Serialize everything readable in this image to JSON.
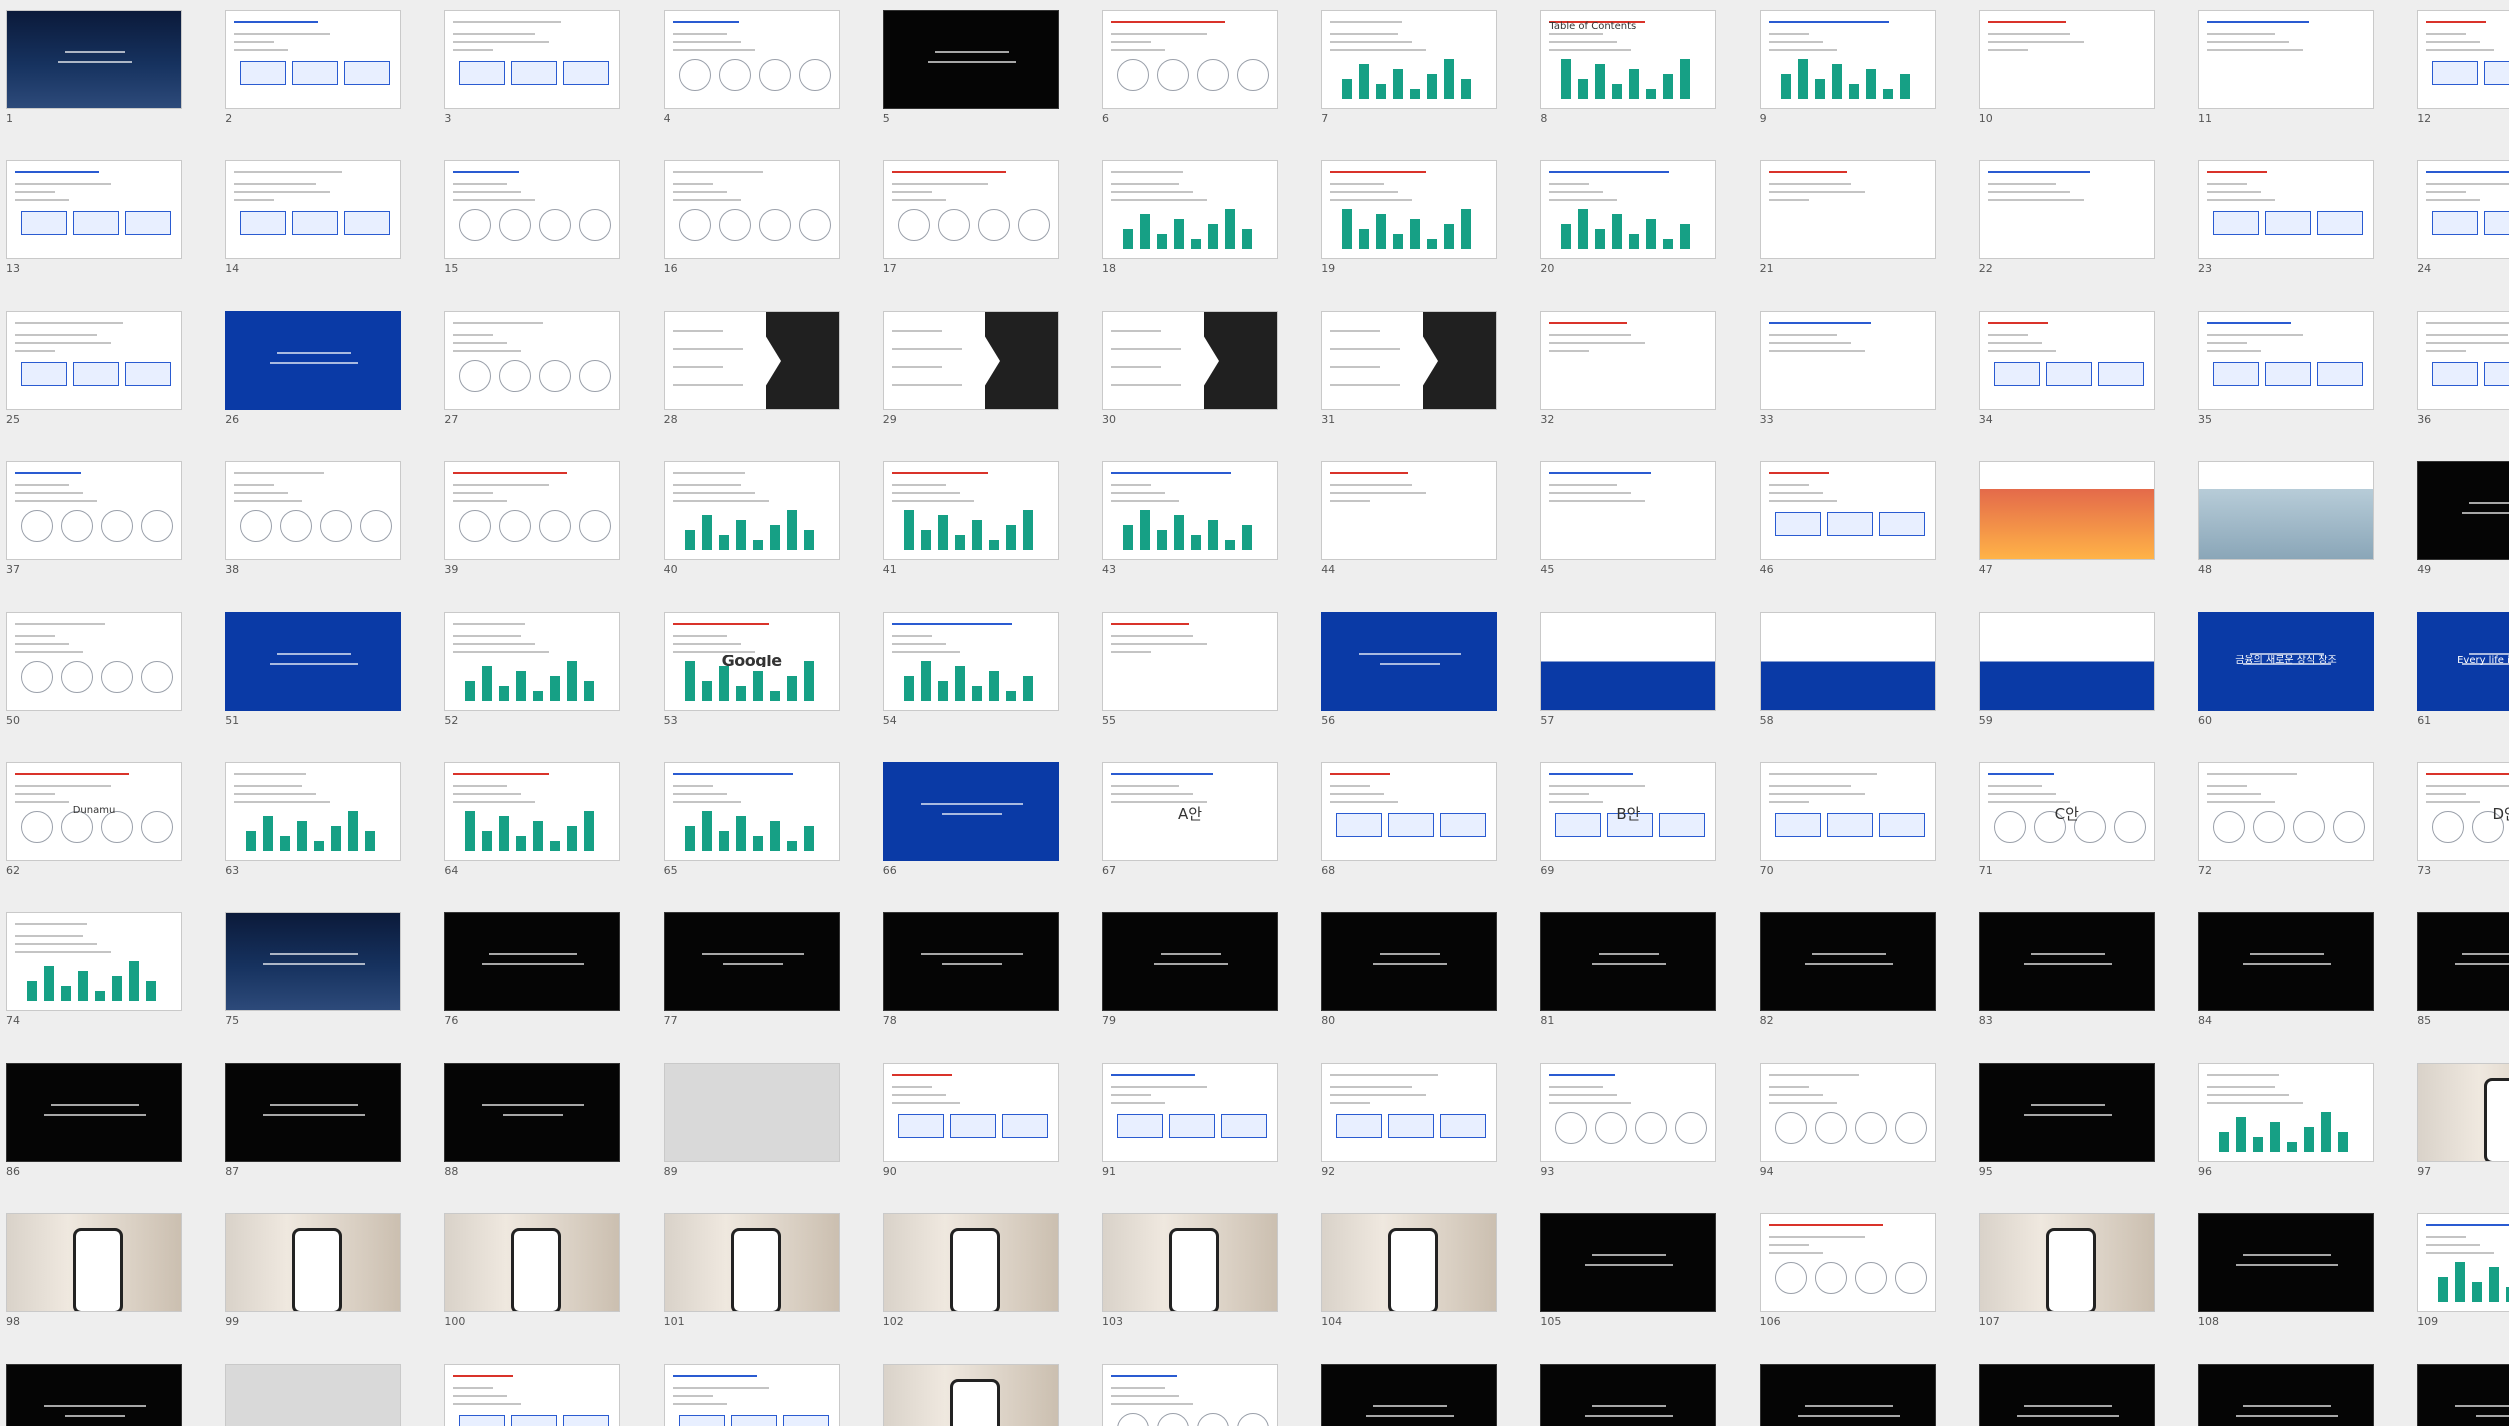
{
  "slides": [
    {
      "n": "1",
      "kind": "city",
      "text": ""
    },
    {
      "n": "2",
      "kind": "white",
      "text": ""
    },
    {
      "n": "3",
      "kind": "white",
      "text": ""
    },
    {
      "n": "4",
      "kind": "white",
      "text": ""
    },
    {
      "n": "5",
      "kind": "black",
      "text": ""
    },
    {
      "n": "6",
      "kind": "white",
      "text": ""
    },
    {
      "n": "7",
      "kind": "white",
      "text": ""
    },
    {
      "n": "8",
      "kind": "white",
      "text": "Table of Contents"
    },
    {
      "n": "9",
      "kind": "white",
      "text": ""
    },
    {
      "n": "10",
      "kind": "white",
      "text": ""
    },
    {
      "n": "11",
      "kind": "white",
      "text": ""
    },
    {
      "n": "12",
      "kind": "white",
      "text": ""
    },
    {
      "n": "13",
      "kind": "white",
      "text": ""
    },
    {
      "n": "14",
      "kind": "white",
      "text": ""
    },
    {
      "n": "15",
      "kind": "white",
      "text": ""
    },
    {
      "n": "16",
      "kind": "white",
      "text": ""
    },
    {
      "n": "17",
      "kind": "white",
      "text": ""
    },
    {
      "n": "18",
      "kind": "white",
      "text": ""
    },
    {
      "n": "19",
      "kind": "white",
      "text": ""
    },
    {
      "n": "20",
      "kind": "white",
      "text": ""
    },
    {
      "n": "21",
      "kind": "white",
      "text": ""
    },
    {
      "n": "22",
      "kind": "white",
      "text": ""
    },
    {
      "n": "23",
      "kind": "white",
      "text": ""
    },
    {
      "n": "24",
      "kind": "white",
      "text": ""
    },
    {
      "n": "25",
      "kind": "white",
      "text": ""
    },
    {
      "n": "26",
      "kind": "blue",
      "text": ""
    },
    {
      "n": "27",
      "kind": "white",
      "text": ""
    },
    {
      "n": "28",
      "kind": "split",
      "text": ""
    },
    {
      "n": "29",
      "kind": "split",
      "text": ""
    },
    {
      "n": "30",
      "kind": "split",
      "text": ""
    },
    {
      "n": "31",
      "kind": "split",
      "text": ""
    },
    {
      "n": "32",
      "kind": "white",
      "text": ""
    },
    {
      "n": "33",
      "kind": "white",
      "text": ""
    },
    {
      "n": "34",
      "kind": "white",
      "text": ""
    },
    {
      "n": "35",
      "kind": "white",
      "text": ""
    },
    {
      "n": "36",
      "kind": "white",
      "text": ""
    },
    {
      "n": "37",
      "kind": "white",
      "text": ""
    },
    {
      "n": "38",
      "kind": "white",
      "text": ""
    },
    {
      "n": "39",
      "kind": "white",
      "text": ""
    },
    {
      "n": "40",
      "kind": "white",
      "text": ""
    },
    {
      "n": "41",
      "kind": "white",
      "text": ""
    },
    {
      "n": "43",
      "kind": "white",
      "text": ""
    },
    {
      "n": "44",
      "kind": "white",
      "text": ""
    },
    {
      "n": "45",
      "kind": "white",
      "text": ""
    },
    {
      "n": "46",
      "kind": "white",
      "text": ""
    },
    {
      "n": "47",
      "kind": "red",
      "text": ""
    },
    {
      "n": "48",
      "kind": "store",
      "text": ""
    },
    {
      "n": "49",
      "kind": "black",
      "text": ""
    },
    {
      "n": "50",
      "kind": "white",
      "text": ""
    },
    {
      "n": "51",
      "kind": "blue",
      "text": ""
    },
    {
      "n": "52",
      "kind": "white",
      "text": ""
    },
    {
      "n": "53",
      "kind": "white",
      "text": "Google"
    },
    {
      "n": "54",
      "kind": "white",
      "text": ""
    },
    {
      "n": "55",
      "kind": "white",
      "text": ""
    },
    {
      "n": "56",
      "kind": "blue",
      "text": ""
    },
    {
      "n": "57",
      "kind": "half",
      "text": ""
    },
    {
      "n": "58",
      "kind": "half",
      "text": ""
    },
    {
      "n": "59",
      "kind": "half",
      "text": ""
    },
    {
      "n": "60",
      "kind": "blue",
      "text": "금융의 새로운 상식 창조"
    },
    {
      "n": "61",
      "kind": "blue",
      "text": "Every life investme"
    },
    {
      "n": "62",
      "kind": "white",
      "text": "Dunamu"
    },
    {
      "n": "63",
      "kind": "white",
      "text": ""
    },
    {
      "n": "64",
      "kind": "white",
      "text": ""
    },
    {
      "n": "65",
      "kind": "white",
      "text": ""
    },
    {
      "n": "66",
      "kind": "blue",
      "text": ""
    },
    {
      "n": "67",
      "kind": "white",
      "text": "A안"
    },
    {
      "n": "68",
      "kind": "white",
      "text": ""
    },
    {
      "n": "69",
      "kind": "white",
      "text": "B안"
    },
    {
      "n": "70",
      "kind": "white",
      "text": ""
    },
    {
      "n": "71",
      "kind": "white",
      "text": "C안"
    },
    {
      "n": "72",
      "kind": "white",
      "text": ""
    },
    {
      "n": "73",
      "kind": "white",
      "text": "D안"
    },
    {
      "n": "74",
      "kind": "white",
      "text": ""
    },
    {
      "n": "75",
      "kind": "city",
      "text": ""
    },
    {
      "n": "76",
      "kind": "black",
      "text": ""
    },
    {
      "n": "77",
      "kind": "black",
      "text": ""
    },
    {
      "n": "78",
      "kind": "black",
      "text": ""
    },
    {
      "n": "79",
      "kind": "black",
      "text": ""
    },
    {
      "n": "80",
      "kind": "black",
      "text": ""
    },
    {
      "n": "81",
      "kind": "black",
      "text": ""
    },
    {
      "n": "82",
      "kind": "black",
      "text": ""
    },
    {
      "n": "83",
      "kind": "black",
      "text": ""
    },
    {
      "n": "84",
      "kind": "black",
      "text": ""
    },
    {
      "n": "85",
      "kind": "black",
      "text": ""
    },
    {
      "n": "86",
      "kind": "black",
      "text": ""
    },
    {
      "n": "87",
      "kind": "black",
      "text": ""
    },
    {
      "n": "88",
      "kind": "black",
      "text": ""
    },
    {
      "n": "89",
      "kind": "grey",
      "text": ""
    },
    {
      "n": "90",
      "kind": "white",
      "text": ""
    },
    {
      "n": "91",
      "kind": "white",
      "text": ""
    },
    {
      "n": "92",
      "kind": "white",
      "text": ""
    },
    {
      "n": "93",
      "kind": "white",
      "text": ""
    },
    {
      "n": "94",
      "kind": "white",
      "text": ""
    },
    {
      "n": "95",
      "kind": "black",
      "text": ""
    },
    {
      "n": "96",
      "kind": "white",
      "text": ""
    },
    {
      "n": "97",
      "kind": "photo",
      "text": ""
    },
    {
      "n": "98",
      "kind": "photo",
      "text": ""
    },
    {
      "n": "99",
      "kind": "photo",
      "text": ""
    },
    {
      "n": "100",
      "kind": "photo",
      "text": ""
    },
    {
      "n": "101",
      "kind": "photo",
      "text": ""
    },
    {
      "n": "102",
      "kind": "photo",
      "text": ""
    },
    {
      "n": "103",
      "kind": "photo",
      "text": ""
    },
    {
      "n": "104",
      "kind": "photo",
      "text": ""
    },
    {
      "n": "105",
      "kind": "black",
      "text": ""
    },
    {
      "n": "106",
      "kind": "white",
      "text": ""
    },
    {
      "n": "107",
      "kind": "photo",
      "text": ""
    },
    {
      "n": "108",
      "kind": "black",
      "text": ""
    },
    {
      "n": "109",
      "kind": "white",
      "text": ""
    },
    {
      "n": "",
      "kind": "black",
      "text": ""
    },
    {
      "n": "",
      "kind": "grey",
      "text": ""
    },
    {
      "n": "",
      "kind": "white",
      "text": ""
    },
    {
      "n": "",
      "kind": "white",
      "text": ""
    },
    {
      "n": "",
      "kind": "photo",
      "text": ""
    },
    {
      "n": "",
      "kind": "white",
      "text": ""
    },
    {
      "n": "",
      "kind": "black",
      "text": ""
    },
    {
      "n": "",
      "kind": "black",
      "text": ""
    },
    {
      "n": "",
      "kind": "black",
      "text": ""
    },
    {
      "n": "",
      "kind": "black",
      "text": ""
    },
    {
      "n": "",
      "kind": "black",
      "text": ""
    },
    {
      "n": "",
      "kind": "black",
      "text": ""
    }
  ]
}
